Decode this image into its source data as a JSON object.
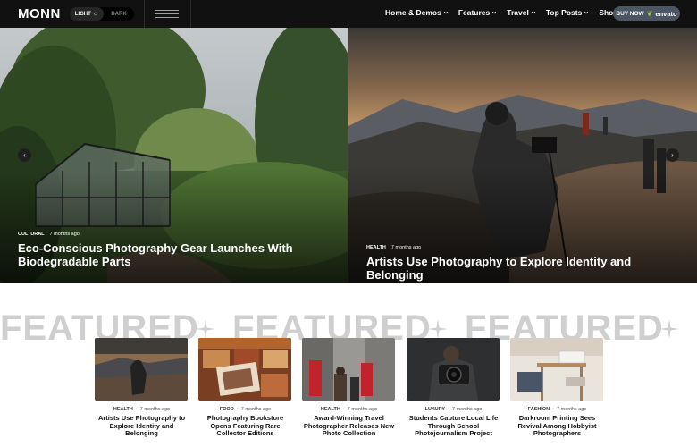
{
  "header": {
    "logo": "MONN",
    "mode_light": "LIGHT",
    "mode_dark": "DARK",
    "nav": [
      {
        "label": "Home & Demos"
      },
      {
        "label": "Features"
      },
      {
        "label": "Travel"
      },
      {
        "label": "Top Posts"
      },
      {
        "label": "Shop"
      }
    ],
    "buy_label": "BUY NOW",
    "buy_brand": "envato"
  },
  "hero": [
    {
      "category": "CULTURAL",
      "time": "7 months ago",
      "title": "Eco-Conscious Photography Gear Launches With Biodegradable Parts"
    },
    {
      "category": "HEALTH",
      "time": "7 months ago",
      "title": "Artists Use Photography to Explore Identity and Belonging"
    }
  ],
  "featured": {
    "word": "FEATURED"
  },
  "cards": [
    {
      "category": "HEALTH",
      "time": "7 months ago",
      "title": "Artists Use Photography to Explore Identity and Belonging"
    },
    {
      "category": "FOOD",
      "time": "7 months ago",
      "title": "Photography Bookstore Opens Featuring Rare Collector Editions"
    },
    {
      "category": "HEALTH",
      "time": "7 months ago",
      "title": "Award-Winning Travel Photographer Releases New Photo Collection"
    },
    {
      "category": "LUXURY",
      "time": "7 months ago",
      "title": "Students Capture Local Life Through School Photojournalism Project"
    },
    {
      "category": "FASHION",
      "time": "7 months ago",
      "title": "Darkroom Printing Sees Revival Among Hobbyist Photographers"
    }
  ],
  "colors": {
    "header_bg": "#111111",
    "buy_button": "#4b5563",
    "featured_text": "#cfcfcf"
  }
}
